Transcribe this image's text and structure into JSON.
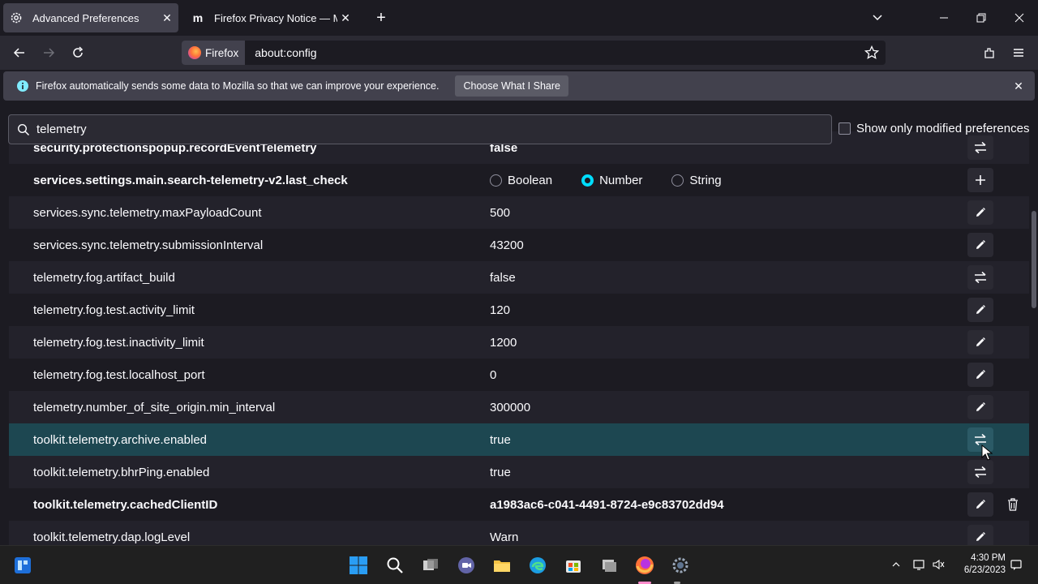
{
  "tabs": [
    {
      "label": "Advanced Preferences",
      "active": true
    },
    {
      "label": "Firefox Privacy Notice — Mozill",
      "active": false
    }
  ],
  "urlbar": {
    "identity": "Firefox",
    "url": "about:config"
  },
  "notification": {
    "text": "Firefox automatically sends some data to Mozilla so that we can improve your experience.",
    "button": "Choose What I Share"
  },
  "search": {
    "value": "telemetry"
  },
  "modified_only_label": "Show only modified preferences",
  "prefs": [
    {
      "name": "security.protectionspopup.recordEventTelemetry",
      "value": "false",
      "bold": true,
      "action": "toggle"
    },
    {
      "name": "services.settings.main.search-telemetry-v2.last_check",
      "value": "",
      "bold": true,
      "action": "add",
      "radios": [
        "Boolean",
        "Number",
        "String"
      ],
      "selected": "Number"
    },
    {
      "name": "services.sync.telemetry.maxPayloadCount",
      "value": "500",
      "bold": false,
      "action": "edit"
    },
    {
      "name": "services.sync.telemetry.submissionInterval",
      "value": "43200",
      "bold": false,
      "action": "edit"
    },
    {
      "name": "telemetry.fog.artifact_build",
      "value": "false",
      "bold": false,
      "action": "toggle"
    },
    {
      "name": "telemetry.fog.test.activity_limit",
      "value": "120",
      "bold": false,
      "action": "edit"
    },
    {
      "name": "telemetry.fog.test.inactivity_limit",
      "value": "1200",
      "bold": false,
      "action": "edit"
    },
    {
      "name": "telemetry.fog.test.localhost_port",
      "value": "0",
      "bold": false,
      "action": "edit"
    },
    {
      "name": "telemetry.number_of_site_origin.min_interval",
      "value": "300000",
      "bold": false,
      "action": "edit"
    },
    {
      "name": "toolkit.telemetry.archive.enabled",
      "value": "true",
      "bold": false,
      "action": "toggle",
      "highlight": true
    },
    {
      "name": "toolkit.telemetry.bhrPing.enabled",
      "value": "true",
      "bold": false,
      "action": "toggle"
    },
    {
      "name": "toolkit.telemetry.cachedClientID",
      "value": "a1983ac6-c041-4491-8724-e9c83702dd94",
      "bold": true,
      "action": "edit",
      "delete": true
    },
    {
      "name": "toolkit.telemetry.dap.logLevel",
      "value": "Warn",
      "bold": false,
      "action": "edit"
    }
  ],
  "clock": {
    "time": "4:30 PM",
    "date": "6/23/2023"
  },
  "taskbar_apps": [
    "windows-start-icon",
    "search-icon",
    "task-view-icon",
    "teams-icon",
    "file-explorer-icon",
    "edge-icon",
    "store-icon",
    "terminal-icon",
    "firefox-icon",
    "settings-icon"
  ]
}
